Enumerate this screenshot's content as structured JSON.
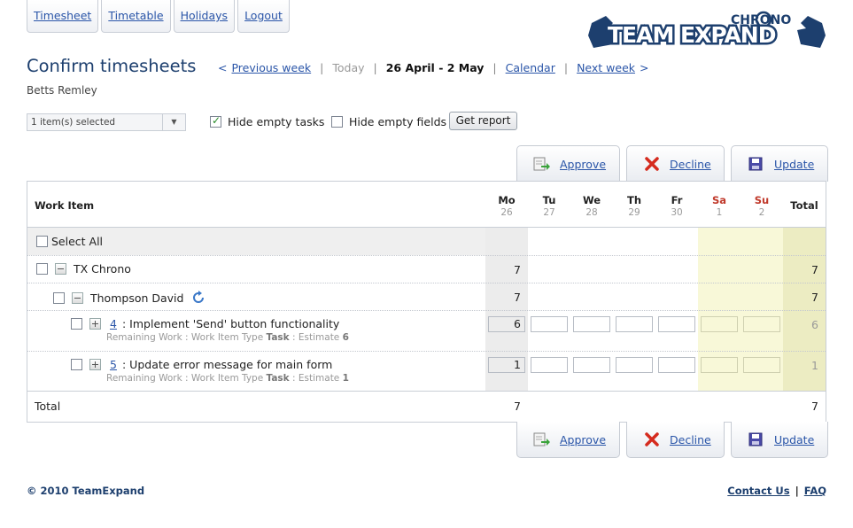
{
  "nav": {
    "items": [
      "Timesheet",
      "Timetable",
      "Holidays",
      "Logout"
    ]
  },
  "logo": {
    "top_text": "CHRONO",
    "main_text": "TEAM EXPAND"
  },
  "page": {
    "title": "Confirm timesheets",
    "user": "Betts Remley"
  },
  "weeknav": {
    "prev_arrow": "<",
    "prev_label": "Previous week",
    "sep": "|",
    "today_label": "Today",
    "range": "26 April - 2 May",
    "calendar_label": "Calendar",
    "next_label": "Next week",
    "next_arrow": ">"
  },
  "filters": {
    "selected_text": "1 item(s) selected",
    "hide_empty_tasks_label": "Hide empty tasks",
    "hide_empty_tasks_checked": true,
    "hide_empty_fields_label": "Hide empty fields",
    "hide_empty_fields_checked": false,
    "report_button": "Get report"
  },
  "actions": {
    "approve": "Approve",
    "decline": "Decline",
    "update": "Update",
    "approve_icon": "approve-doc-icon",
    "decline_icon": "red-x-icon",
    "update_icon": "floppy-disk-icon"
  },
  "grid": {
    "work_item_header": "Work Item",
    "total_header": "Total",
    "days": [
      {
        "name": "Mo",
        "date": "26"
      },
      {
        "name": "Tu",
        "date": "27"
      },
      {
        "name": "We",
        "date": "28"
      },
      {
        "name": "Th",
        "date": "29"
      },
      {
        "name": "Fr",
        "date": "30"
      },
      {
        "name": "Sa",
        "date": "1"
      },
      {
        "name": "Su",
        "date": "2"
      }
    ],
    "select_all": "Select All",
    "project": {
      "name": "TX Chrono",
      "mo": "7",
      "total": "7"
    },
    "person": {
      "name": "Thompson David",
      "mo": "7",
      "total": "7"
    },
    "tasks": [
      {
        "id": "4",
        "colon": ":",
        "title": "Implement 'Send' button functionality",
        "remaining": "Remaining Work : Work Item Type",
        "type": "Task",
        "estimate_label": ": Estimate",
        "estimate": "6",
        "mo": "6",
        "total": "6"
      },
      {
        "id": "5",
        "colon": ":",
        "title": "Update error message for main form",
        "remaining": "Remaining Work : Work Item Type",
        "type": "Task",
        "estimate_label": ": Estimate",
        "estimate": "1",
        "mo": "1",
        "total": "1"
      }
    ],
    "total_row": {
      "label": "Total",
      "mo": "7",
      "total": "7"
    }
  },
  "footer": {
    "copyright": "© 2010 TeamExpand",
    "contact": "Contact Us",
    "sep": "|",
    "faq": "FAQ"
  },
  "colors": {
    "title": "#1d3f6e",
    "link": "#2a55a8",
    "weekend_header": "#c0392b",
    "weekend_bg": "#f8f8d8",
    "total_bg": "#ececc2"
  }
}
